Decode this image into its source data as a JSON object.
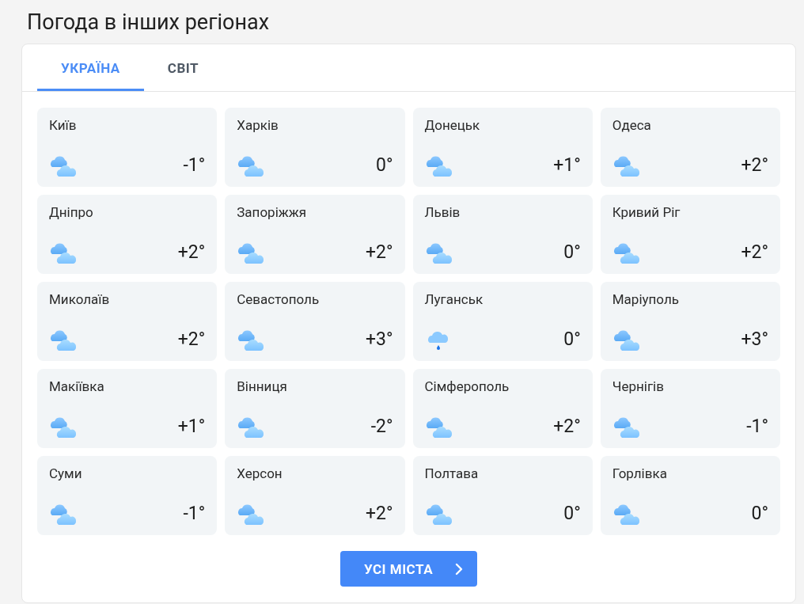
{
  "title": "Погода в інших регіонах",
  "tabs": [
    {
      "label": "УКРАЇНА",
      "selected": true
    },
    {
      "label": "СВІТ",
      "selected": false
    }
  ],
  "cities": [
    {
      "name": "Київ",
      "kind": "cloudy",
      "temp": "-1°"
    },
    {
      "name": "Харків",
      "kind": "cloudy",
      "temp": "0°"
    },
    {
      "name": "Донецьк",
      "kind": "cloudy",
      "temp": "+1°"
    },
    {
      "name": "Одеса",
      "kind": "cloudy",
      "temp": "+2°"
    },
    {
      "name": "Дніпро",
      "kind": "cloudy",
      "temp": "+2°"
    },
    {
      "name": "Запоріжжя",
      "kind": "cloudy",
      "temp": "+2°"
    },
    {
      "name": "Львів",
      "kind": "cloudy",
      "temp": "0°"
    },
    {
      "name": "Кривий Ріг",
      "kind": "cloudy",
      "temp": "+2°"
    },
    {
      "name": "Миколаїв",
      "kind": "cloudy",
      "temp": "+2°"
    },
    {
      "name": "Севастополь",
      "kind": "cloudy",
      "temp": "+3°"
    },
    {
      "name": "Луганськ",
      "kind": "rain",
      "temp": "0°"
    },
    {
      "name": "Маріуполь",
      "kind": "cloudy",
      "temp": "+3°"
    },
    {
      "name": "Макіївка",
      "kind": "cloudy",
      "temp": "+1°"
    },
    {
      "name": "Вінниця",
      "kind": "cloudy",
      "temp": "-2°"
    },
    {
      "name": "Сімферополь",
      "kind": "cloudy",
      "temp": "+2°"
    },
    {
      "name": "Чернігів",
      "kind": "cloudy",
      "temp": "-1°"
    },
    {
      "name": "Суми",
      "kind": "cloudy",
      "temp": "-1°"
    },
    {
      "name": "Херсон",
      "kind": "cloudy",
      "temp": "+2°"
    },
    {
      "name": "Полтава",
      "kind": "cloudy",
      "temp": "0°"
    },
    {
      "name": "Горлівка",
      "kind": "cloudy",
      "temp": "0°"
    }
  ],
  "button": {
    "label": "УСІ МІСТА"
  }
}
